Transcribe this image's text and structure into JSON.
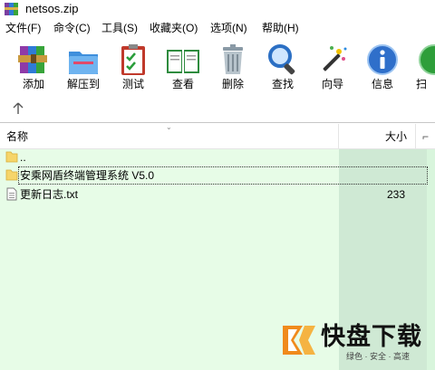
{
  "window": {
    "title": "netsos.zip"
  },
  "menu": [
    "文件(F)",
    "命令(C)",
    "工具(S)",
    "收藏夹(O)",
    "选项(N)",
    "帮助(H)"
  ],
  "toolbar": [
    {
      "label": "添加",
      "icon": "add-archive-icon"
    },
    {
      "label": "解压到",
      "icon": "extract-folder-icon"
    },
    {
      "label": "测试",
      "icon": "test-clipboard-icon"
    },
    {
      "label": "查看",
      "icon": "view-book-icon"
    },
    {
      "label": "删除",
      "icon": "trash-icon"
    },
    {
      "label": "查找",
      "icon": "magnifier-icon"
    },
    {
      "label": "向导",
      "icon": "wizard-wand-icon"
    },
    {
      "label": "信息",
      "icon": "info-icon"
    },
    {
      "label": "扫",
      "icon": "scan-icon"
    }
  ],
  "columns": {
    "name": "名称",
    "size": "大小"
  },
  "files": [
    {
      "name": "..",
      "size": "",
      "icon": "folder-icon"
    },
    {
      "name": "安乘网盾终端管理系统 V5.0",
      "size": "",
      "icon": "folder-icon"
    },
    {
      "name": "更新日志.txt",
      "size": "233",
      "icon": "text-file-icon"
    }
  ],
  "watermark": {
    "brand_big": "快盘下载",
    "tagline": "绿色 · 安全 · 高速"
  },
  "colors": {
    "list_bg": "#e7fce7",
    "size_col_bg": "#cfe9d4",
    "folder": "#f6d56a"
  }
}
